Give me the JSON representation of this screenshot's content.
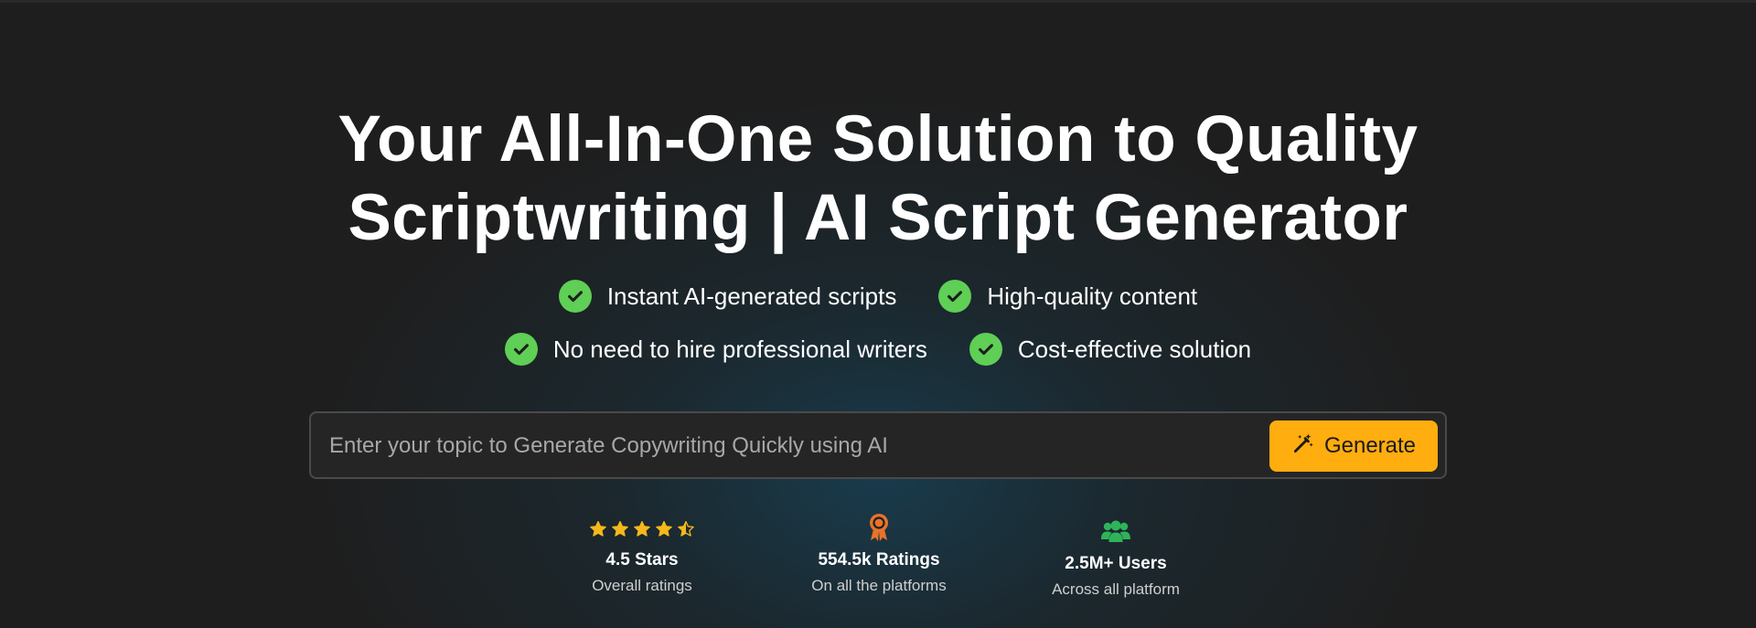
{
  "hero": {
    "title_line1": "Your All-In-One Solution to Quality",
    "title_line2": "Scriptwriting | AI Script Generator"
  },
  "features": [
    "Instant AI-generated scripts",
    "High-quality content",
    "No need to hire professional writers",
    "Cost-effective solution"
  ],
  "search": {
    "placeholder": "Enter your topic to Generate Copywriting Quickly using AI",
    "value": "",
    "button_label": "Generate",
    "button_icon": "magic-wand-icon"
  },
  "stats": [
    {
      "value": "4.5 Stars",
      "caption": "Overall ratings",
      "icon": "star-rating-icon",
      "rating": 4.5,
      "max_rating": 5
    },
    {
      "value": "554.5k Ratings",
      "caption": "On all the platforms",
      "icon": "award-badge-icon"
    },
    {
      "value": "2.5M+ Users",
      "caption": "Across all platform",
      "icon": "users-group-icon"
    }
  ],
  "colors": {
    "background": "#1e1e1e",
    "accent": "#ffad0f",
    "check": "#5fcf55",
    "star": "#f5b81c",
    "award": "#e8732a",
    "users": "#2fb35a"
  }
}
